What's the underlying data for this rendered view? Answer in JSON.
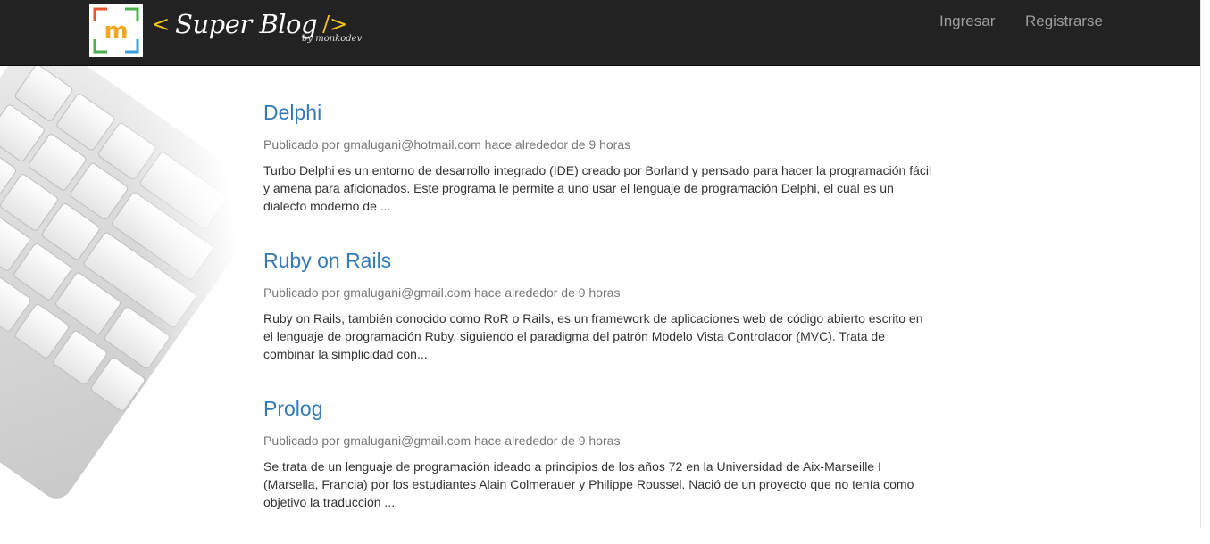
{
  "header": {
    "brand_open": "<",
    "brand_name": "Super Blog",
    "brand_close": "/>",
    "brand_by": "by monkodev",
    "logo_letter": "m",
    "login_label": "Ingresar",
    "register_label": "Registrarse"
  },
  "posts": [
    {
      "title": "Delphi",
      "meta": "Publicado por gmalugani@hotmail.com hace alrededor de 9 horas",
      "excerpt": "Turbo Delphi es un entorno de desarrollo integrado (IDE) creado por Borland y pensado para hacer la programación fácil y amena para aficionados. Este programa le permite a uno usar el lenguaje de programación Delphi, el cual es un dialecto moderno de ..."
    },
    {
      "title": "Ruby on Rails",
      "meta": "Publicado por gmalugani@gmail.com hace alrededor de 9 horas",
      "excerpt": "Ruby on Rails, también conocido como RoR o Rails, es un framework de aplicaciones web de código abierto escrito en el lenguaje de programación Ruby, siguiendo el paradigma del patrón Modelo Vista Controlador (MVC). Trata de combinar la simplicidad con..."
    },
    {
      "title": "Prolog",
      "meta": "Publicado por gmalugani@gmail.com hace alrededor de 9 horas",
      "excerpt": "Se trata de un lenguaje de programación ideado a principios de los años 72 en la Universidad de Aix-Marseille I (Marsella, Francia) por los estudiantes Alain Colmerauer y Philippe Roussel. Nació de un proyecto que no tenía como objetivo la traducción ..."
    }
  ],
  "colors": {
    "navbar": "#222222",
    "link": "#337ab7",
    "brand_accent": "#f0c419"
  }
}
